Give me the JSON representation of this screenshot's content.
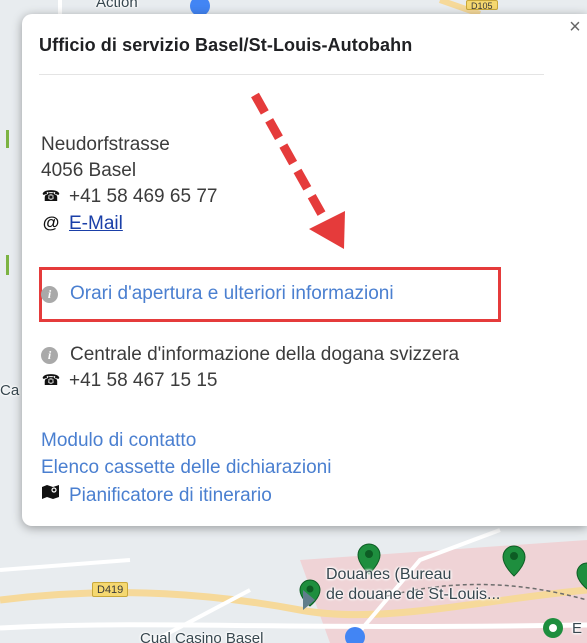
{
  "map": {
    "road_d419": "D419",
    "road_top": "D105",
    "top_label": "Action",
    "left_label": "Ca",
    "douanes_label_1": "Douanes (Bureau",
    "douanes_label_2": "de douane de St-Louis...",
    "bottom_label": "Cual Casino Basel",
    "right_edge_label": "E",
    "colors": {
      "pin_green": "#1e8e3e",
      "road_yellow": "#f5d870",
      "pink_area": "#efd3d6"
    }
  },
  "popup": {
    "title": "Ufficio di servizio Basel/St-Louis-Autobahn",
    "close_label": "×",
    "street": "Neudorfstrasse",
    "city": "4056 Basel",
    "phone": "+41 58 469 65 77",
    "email_label": "E-Mail",
    "hours_link": "Orari d'apertura e ulteriori informazioni",
    "central_info": "Centrale d'informazione della dogana svizzera",
    "central_phone": "+41 58 467 15 15",
    "contact_form_link": "Modulo di contatto",
    "boxes_link": "Elenco cassette delle dichiarazioni",
    "route_planner_link": "Pianificatore di itinerario",
    "icons": {
      "phone": "phone-icon",
      "email": "at-icon",
      "info": "info-icon",
      "route": "map-route-icon"
    },
    "colors": {
      "link": "#4a7fd0",
      "highlight": "#e53b3b"
    }
  }
}
